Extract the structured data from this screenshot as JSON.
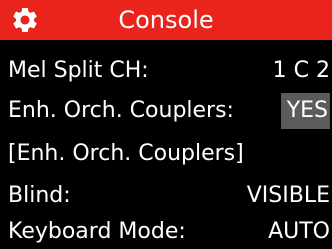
{
  "header": {
    "title": "Console",
    "icon": "gear-icon",
    "background_color": "#e8241c"
  },
  "menu": {
    "selected_value_background": "#5b5b5b",
    "items": [
      {
        "label": "Mel Split CH:",
        "value": "1 C 2"
      },
      {
        "label": "Enh. Orch. Couplers:",
        "value": "YES",
        "selected": true
      },
      {
        "label": "[Enh. Orch. Couplers]",
        "value": ""
      },
      {
        "label": "Blind:",
        "value": "VISIBLE"
      },
      {
        "label": "Keyboard Mode:",
        "value": "AUTO"
      }
    ]
  }
}
